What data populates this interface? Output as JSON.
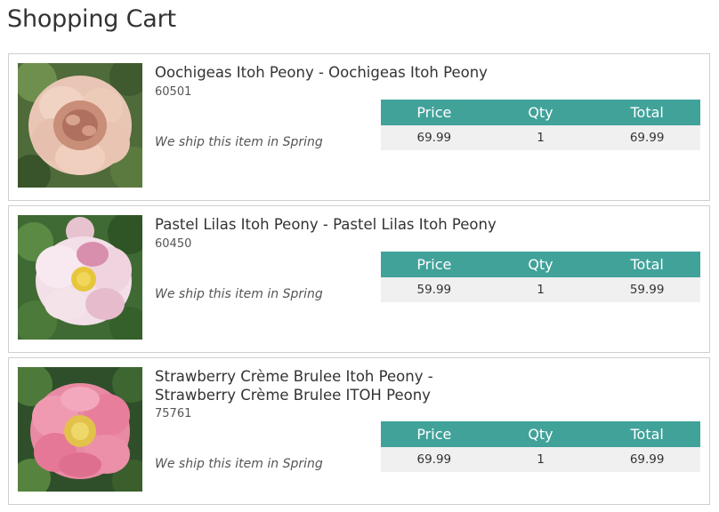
{
  "page": {
    "title": "Shopping Cart"
  },
  "table_headers": {
    "price": "Price",
    "qty": "Qty",
    "total": "Total"
  },
  "items": [
    {
      "name": "Oochigeas Itoh Peony - Oochigeas Itoh Peony",
      "sku": "60501",
      "ship_note": "We ship this item in Spring",
      "price": "69.99",
      "qty": "1",
      "total": "69.99",
      "image": "peach peony flower photo"
    },
    {
      "name": "Pastel Lilas Itoh Peony - Pastel Lilas Itoh Peony",
      "sku": "60450",
      "ship_note": "We ship this item in Spring",
      "price": "59.99",
      "qty": "1",
      "total": "59.99",
      "image": "pale pink peony flower photo"
    },
    {
      "name": "Strawberry Crème Brulee Itoh Peony - Strawberry Crème Brulee ITOH Peony",
      "sku": "75761",
      "ship_note": "We ship this item in Spring",
      "price": "69.99",
      "qty": "1",
      "total": "69.99",
      "image": "pink peony flower photo"
    }
  ],
  "colors": {
    "header_teal": "#41a29a",
    "row_gray": "#f0f0f0",
    "border": "#cfcfcf"
  }
}
